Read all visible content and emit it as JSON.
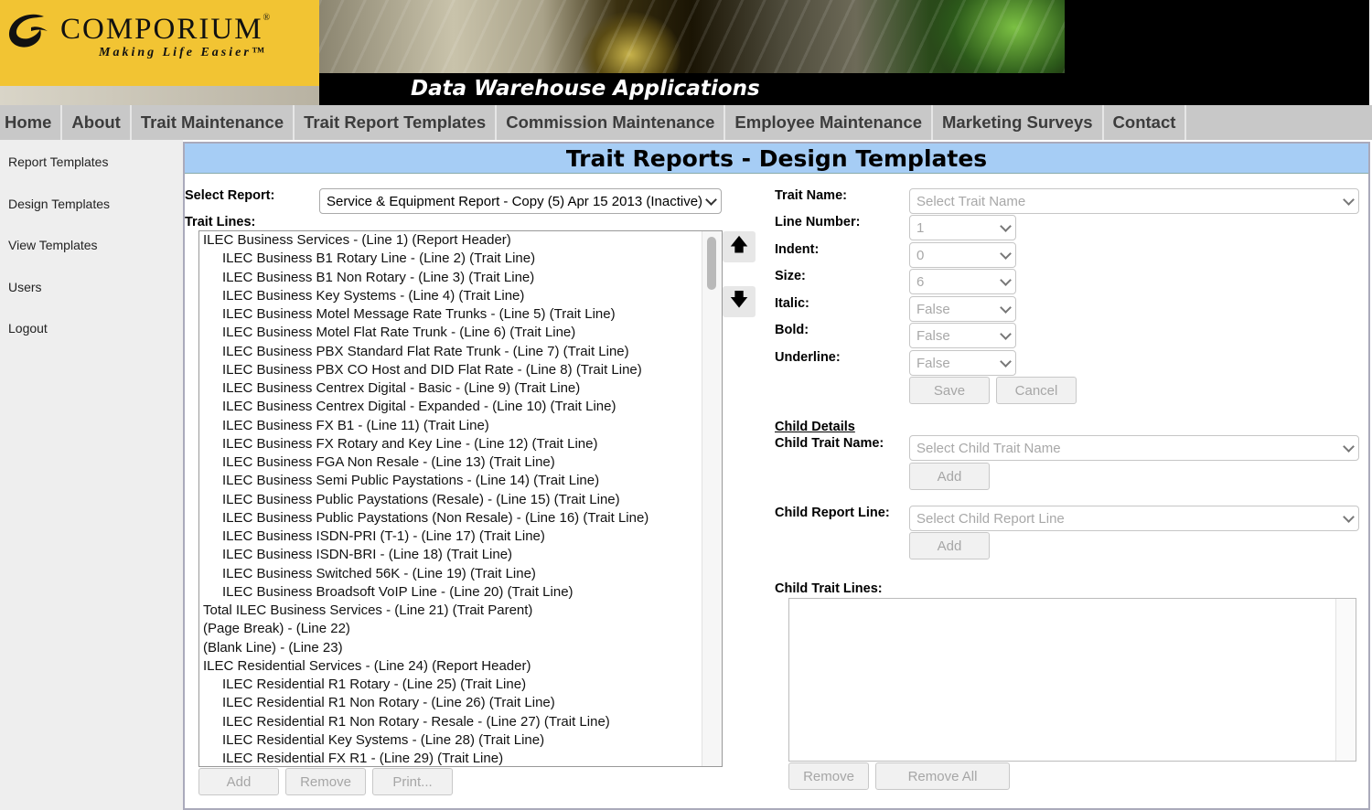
{
  "brand": {
    "name": "COMPORIUM",
    "registered": "®",
    "tagline": "Making Life Easier™",
    "banner_title": "Data Warehouse Applications"
  },
  "nav": [
    "Home",
    "About",
    "Trait Maintenance",
    "Trait Report Templates",
    "Commission Maintenance",
    "Employee Maintenance",
    "Marketing Surveys",
    "Contact"
  ],
  "sidebar": [
    "Report Templates",
    "Design Templates",
    "View Templates",
    "Users",
    "Logout"
  ],
  "page_title": "Trait Reports - Design Templates",
  "left": {
    "select_report_label": "Select Report:",
    "select_report_value": "Service & Equipment Report - Copy (5) Apr 15 2013 (Inactive)",
    "trait_lines_label": "Trait Lines:",
    "trait_lines": [
      {
        "text": "ILEC Business Services - (Line 1) (Report Header)",
        "level": 0
      },
      {
        "text": "ILEC Business B1 Rotary Line - (Line 2) (Trait Line)",
        "level": 1
      },
      {
        "text": "ILEC Business B1 Non Rotary - (Line 3) (Trait Line)",
        "level": 1
      },
      {
        "text": "ILEC Business Key Systems - (Line 4) (Trait Line)",
        "level": 1
      },
      {
        "text": "ILEC Business Motel Message Rate Trunks - (Line 5) (Trait Line)",
        "level": 1
      },
      {
        "text": "ILEC Business Motel Flat Rate Trunk - (Line 6) (Trait Line)",
        "level": 1
      },
      {
        "text": "ILEC Business PBX Standard Flat Rate Trunk - (Line 7) (Trait Line)",
        "level": 1
      },
      {
        "text": "ILEC Business PBX CO Host and DID Flat Rate - (Line 8) (Trait Line)",
        "level": 1
      },
      {
        "text": "ILEC Business Centrex Digital - Basic - (Line 9) (Trait Line)",
        "level": 1
      },
      {
        "text": "ILEC Business Centrex Digital - Expanded - (Line 10) (Trait Line)",
        "level": 1
      },
      {
        "text": "ILEC Business FX B1 - (Line 11) (Trait Line)",
        "level": 1
      },
      {
        "text": "ILEC Business FX Rotary and Key Line - (Line 12) (Trait Line)",
        "level": 1
      },
      {
        "text": "ILEC Business FGA Non Resale - (Line 13) (Trait Line)",
        "level": 1
      },
      {
        "text": "ILEC Business Semi Public Paystations - (Line 14) (Trait Line)",
        "level": 1
      },
      {
        "text": "ILEC Business Public Paystations (Resale) - (Line 15) (Trait Line)",
        "level": 1
      },
      {
        "text": "ILEC Business Public Paystations (Non Resale) - (Line 16) (Trait Line)",
        "level": 1
      },
      {
        "text": "ILEC Business ISDN-PRI (T-1) - (Line 17) (Trait Line)",
        "level": 1
      },
      {
        "text": "ILEC Business ISDN-BRI - (Line 18) (Trait Line)",
        "level": 1
      },
      {
        "text": "ILEC Business Switched 56K - (Line 19) (Trait Line)",
        "level": 1
      },
      {
        "text": "ILEC Business Broadsoft VoIP Line - (Line 20) (Trait Line)",
        "level": 1
      },
      {
        "text": "Total ILEC Business Services - (Line 21) (Trait Parent)",
        "level": 0
      },
      {
        "text": "(Page Break) - (Line 22)",
        "level": 0
      },
      {
        "text": "(Blank Line) - (Line 23)",
        "level": 0
      },
      {
        "text": "ILEC Residential Services - (Line 24) (Report Header)",
        "level": 0
      },
      {
        "text": "ILEC Residential R1 Rotary - (Line 25) (Trait Line)",
        "level": 1
      },
      {
        "text": "ILEC Residential R1 Non Rotary - (Line 26) (Trait Line)",
        "level": 1
      },
      {
        "text": "ILEC Residential R1 Non Rotary - Resale - (Line 27) (Trait Line)",
        "level": 1
      },
      {
        "text": "ILEC Residential Key Systems - (Line 28) (Trait Line)",
        "level": 1
      },
      {
        "text": "ILEC Residential FX R1 - (Line 29) (Trait Line)",
        "level": 1
      }
    ],
    "buttons": {
      "add": "Add",
      "remove": "Remove",
      "print": "Print..."
    },
    "arrows": {
      "up": "🡅",
      "down": "🡇"
    }
  },
  "right": {
    "trait_name_label": "Trait Name:",
    "trait_name_placeholder": "Select Trait Name",
    "line_number_label": "Line Number:",
    "line_number_value": "1",
    "indent_label": "Indent:",
    "indent_value": "0",
    "size_label": "Size:",
    "size_value": "6",
    "italic_label": "Italic:",
    "italic_value": "False",
    "bold_label": "Bold:",
    "bold_value": "False",
    "underline_label": "Underline:",
    "underline_value": "False",
    "save": "Save",
    "cancel": "Cancel",
    "child_details_heading": "Child Details",
    "child_trait_name_label": "Child Trait Name:",
    "child_trait_name_placeholder": "Select Child Trait Name",
    "child_trait_add": "Add",
    "child_report_line_label": "Child Report Line:",
    "child_report_line_placeholder": "Select Child Report Line",
    "child_report_add": "Add",
    "child_trait_lines_label": "Child Trait Lines:",
    "remove": "Remove",
    "remove_all": "Remove All"
  }
}
